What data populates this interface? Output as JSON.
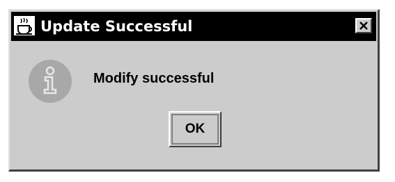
{
  "window": {
    "title": "Update Successful",
    "app_icon": "java-cup-icon",
    "close_icon": "close-icon"
  },
  "body": {
    "icon": "info-icon",
    "message": "Modify successful"
  },
  "buttons": {
    "ok_label": "OK"
  },
  "colors": {
    "titlebar": "#000000",
    "title_text": "#ffffff",
    "dialog_bg": "#cccccc",
    "info_icon_bg": "#a8a8a8"
  }
}
